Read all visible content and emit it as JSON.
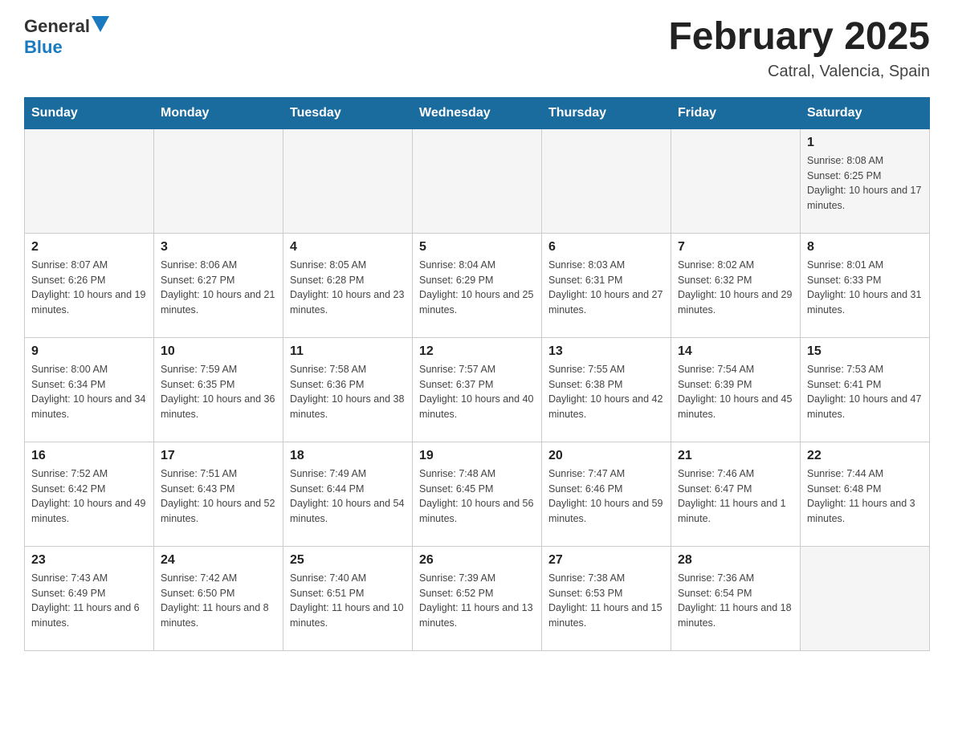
{
  "header": {
    "logo_general": "General",
    "logo_blue": "Blue",
    "month_title": "February 2025",
    "location": "Catral, Valencia, Spain"
  },
  "days_of_week": [
    "Sunday",
    "Monday",
    "Tuesday",
    "Wednesday",
    "Thursday",
    "Friday",
    "Saturday"
  ],
  "weeks": [
    [
      {
        "day": "",
        "info": ""
      },
      {
        "day": "",
        "info": ""
      },
      {
        "day": "",
        "info": ""
      },
      {
        "day": "",
        "info": ""
      },
      {
        "day": "",
        "info": ""
      },
      {
        "day": "",
        "info": ""
      },
      {
        "day": "1",
        "info": "Sunrise: 8:08 AM\nSunset: 6:25 PM\nDaylight: 10 hours and 17 minutes."
      }
    ],
    [
      {
        "day": "2",
        "info": "Sunrise: 8:07 AM\nSunset: 6:26 PM\nDaylight: 10 hours and 19 minutes."
      },
      {
        "day": "3",
        "info": "Sunrise: 8:06 AM\nSunset: 6:27 PM\nDaylight: 10 hours and 21 minutes."
      },
      {
        "day": "4",
        "info": "Sunrise: 8:05 AM\nSunset: 6:28 PM\nDaylight: 10 hours and 23 minutes."
      },
      {
        "day": "5",
        "info": "Sunrise: 8:04 AM\nSunset: 6:29 PM\nDaylight: 10 hours and 25 minutes."
      },
      {
        "day": "6",
        "info": "Sunrise: 8:03 AM\nSunset: 6:31 PM\nDaylight: 10 hours and 27 minutes."
      },
      {
        "day": "7",
        "info": "Sunrise: 8:02 AM\nSunset: 6:32 PM\nDaylight: 10 hours and 29 minutes."
      },
      {
        "day": "8",
        "info": "Sunrise: 8:01 AM\nSunset: 6:33 PM\nDaylight: 10 hours and 31 minutes."
      }
    ],
    [
      {
        "day": "9",
        "info": "Sunrise: 8:00 AM\nSunset: 6:34 PM\nDaylight: 10 hours and 34 minutes."
      },
      {
        "day": "10",
        "info": "Sunrise: 7:59 AM\nSunset: 6:35 PM\nDaylight: 10 hours and 36 minutes."
      },
      {
        "day": "11",
        "info": "Sunrise: 7:58 AM\nSunset: 6:36 PM\nDaylight: 10 hours and 38 minutes."
      },
      {
        "day": "12",
        "info": "Sunrise: 7:57 AM\nSunset: 6:37 PM\nDaylight: 10 hours and 40 minutes."
      },
      {
        "day": "13",
        "info": "Sunrise: 7:55 AM\nSunset: 6:38 PM\nDaylight: 10 hours and 42 minutes."
      },
      {
        "day": "14",
        "info": "Sunrise: 7:54 AM\nSunset: 6:39 PM\nDaylight: 10 hours and 45 minutes."
      },
      {
        "day": "15",
        "info": "Sunrise: 7:53 AM\nSunset: 6:41 PM\nDaylight: 10 hours and 47 minutes."
      }
    ],
    [
      {
        "day": "16",
        "info": "Sunrise: 7:52 AM\nSunset: 6:42 PM\nDaylight: 10 hours and 49 minutes."
      },
      {
        "day": "17",
        "info": "Sunrise: 7:51 AM\nSunset: 6:43 PM\nDaylight: 10 hours and 52 minutes."
      },
      {
        "day": "18",
        "info": "Sunrise: 7:49 AM\nSunset: 6:44 PM\nDaylight: 10 hours and 54 minutes."
      },
      {
        "day": "19",
        "info": "Sunrise: 7:48 AM\nSunset: 6:45 PM\nDaylight: 10 hours and 56 minutes."
      },
      {
        "day": "20",
        "info": "Sunrise: 7:47 AM\nSunset: 6:46 PM\nDaylight: 10 hours and 59 minutes."
      },
      {
        "day": "21",
        "info": "Sunrise: 7:46 AM\nSunset: 6:47 PM\nDaylight: 11 hours and 1 minute."
      },
      {
        "day": "22",
        "info": "Sunrise: 7:44 AM\nSunset: 6:48 PM\nDaylight: 11 hours and 3 minutes."
      }
    ],
    [
      {
        "day": "23",
        "info": "Sunrise: 7:43 AM\nSunset: 6:49 PM\nDaylight: 11 hours and 6 minutes."
      },
      {
        "day": "24",
        "info": "Sunrise: 7:42 AM\nSunset: 6:50 PM\nDaylight: 11 hours and 8 minutes."
      },
      {
        "day": "25",
        "info": "Sunrise: 7:40 AM\nSunset: 6:51 PM\nDaylight: 11 hours and 10 minutes."
      },
      {
        "day": "26",
        "info": "Sunrise: 7:39 AM\nSunset: 6:52 PM\nDaylight: 11 hours and 13 minutes."
      },
      {
        "day": "27",
        "info": "Sunrise: 7:38 AM\nSunset: 6:53 PM\nDaylight: 11 hours and 15 minutes."
      },
      {
        "day": "28",
        "info": "Sunrise: 7:36 AM\nSunset: 6:54 PM\nDaylight: 11 hours and 18 minutes."
      },
      {
        "day": "",
        "info": ""
      }
    ]
  ]
}
